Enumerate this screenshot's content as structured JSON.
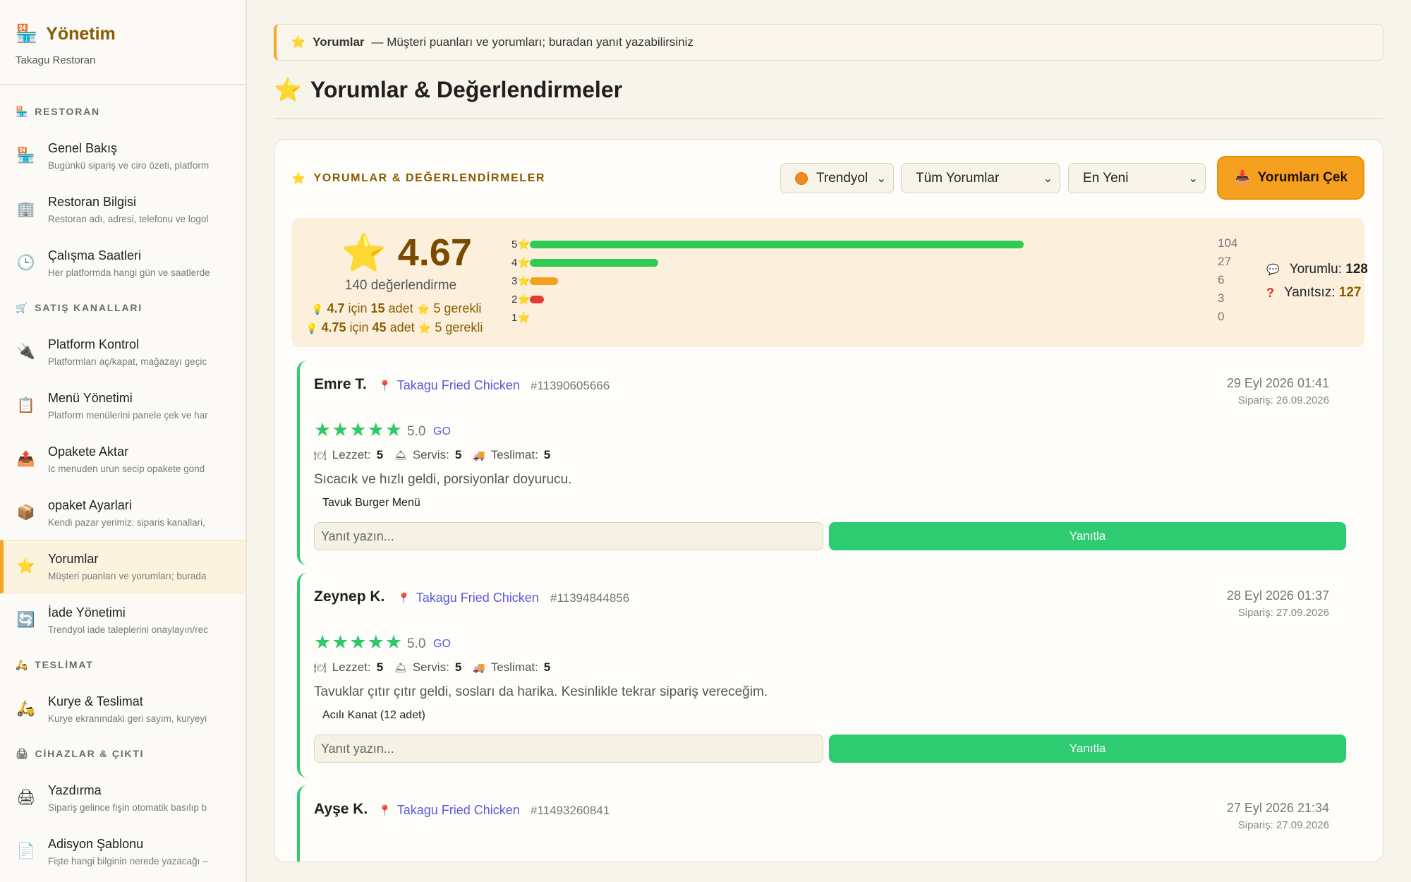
{
  "sidebar": {
    "brand_title": "Yönetim",
    "brand_subtitle": "Takagu Restoran",
    "sections": {
      "restoran": "RESTORAN",
      "satis": "SATIŞ KANALLARI",
      "teslimat": "TESLİMAT",
      "cihazlar": "CİHAZLAR & ÇIKTI"
    },
    "items": [
      {
        "title": "Genel Bakış",
        "desc": "Bugünkü sipariş ve ciro özeti, platform",
        "icon": "🏪"
      },
      {
        "title": "Restoran Bilgisi",
        "desc": "Restoran adı, adresi, telefonu ve logol",
        "icon": "🏢"
      },
      {
        "title": "Çalışma Saatleri",
        "desc": "Her platformda hangi gün ve saatlerde",
        "icon": "🕒"
      },
      {
        "title": "Platform Kontrol",
        "desc": "Platformları aç/kapat, mağazayı geçic",
        "icon": "🔌"
      },
      {
        "title": "Menü Yönetimi",
        "desc": "Platform menülerini panele çek ve har",
        "icon": "📋"
      },
      {
        "title": "Opakete Aktar",
        "desc": "Ic menuden urun secip opakete gond",
        "icon": "📤"
      },
      {
        "title": "opaket Ayarlari",
        "desc": "Kendi pazar yerimiz: siparis kanallari,",
        "icon": "📦"
      },
      {
        "title": "Yorumlar",
        "desc": "Müşteri puanları ve yorumları; burada",
        "icon": "⭐"
      },
      {
        "title": "İade Yönetimi",
        "desc": "Trendyol iade taleplerini onaylayın/rec",
        "icon": "🔄"
      },
      {
        "title": "Kurye & Teslimat",
        "desc": "Kurye ekranındaki geri sayım, kuryeyi",
        "icon": "🛵"
      },
      {
        "title": "Yazdırma",
        "desc": "Sipariş gelince fişin otomatik basılıp b",
        "icon": "🖨"
      },
      {
        "title": "Adisyon Şablonu",
        "desc": "Fişte hangi bilginin nerede yazacağı –",
        "icon": "📄"
      }
    ]
  },
  "banner": {
    "bold": "Yorumlar",
    "text": "— Müşteri puanları ve yorumları; buradan yanıt yazabilirsiniz"
  },
  "page_title": "Yorumlar & Değerlendirmeler",
  "card": {
    "heading": "YORUMLAR & DEĞERLENDİRMELER",
    "platform_select": "Trendyol",
    "filter_select": "Tüm Yorumlar",
    "sort_select": "En Yeni",
    "fetch_button": "Yorumları Çek"
  },
  "summary": {
    "average": "4.67",
    "count_text": "140 değerlendirme",
    "need1": {
      "target": "4.7",
      "mid": "için",
      "count": "15",
      "unit": "adet",
      "stars": "5 gerekli"
    },
    "need2": {
      "target": "4.75",
      "mid": "için",
      "count": "45",
      "unit": "adet",
      "stars": "5 gerekli"
    },
    "distribution": [
      {
        "star": "5",
        "count": 104
      },
      {
        "star": "4",
        "count": 27
      },
      {
        "star": "3",
        "count": 6
      },
      {
        "star": "2",
        "count": 3
      },
      {
        "star": "1",
        "count": 0
      }
    ],
    "with_comment_label": "Yorumlu:",
    "with_comment": "128",
    "unanswered_label": "Yanıtsız:",
    "unanswered": "127"
  },
  "reviews": [
    {
      "name": "Emre T.",
      "branch": "Takagu Fried Chicken",
      "order_no": "#11390605666",
      "date": "29 Eyl 2026 01:41",
      "order_date": "Sipariş: 26.09.2026",
      "stars": "★★★★★",
      "score": "5.0",
      "platform": "GO",
      "taste_label": "Lezzet:",
      "taste": "5",
      "service_label": "Servis:",
      "service": "5",
      "delivery_label": "Teslimat:",
      "delivery": "5",
      "text": "Sıcacık ve hızlı geldi, porsiyonlar doyurucu.",
      "item": "Tavuk Burger Menü",
      "placeholder": "Yanıt yazın...",
      "reply": "Yanıtla"
    },
    {
      "name": "Zeynep K.",
      "branch": "Takagu Fried Chicken",
      "order_no": "#11394844856",
      "date": "28 Eyl 2026 01:37",
      "order_date": "Sipariş: 27.09.2026",
      "stars": "★★★★★",
      "score": "5.0",
      "platform": "GO",
      "taste_label": "Lezzet:",
      "taste": "5",
      "service_label": "Servis:",
      "service": "5",
      "delivery_label": "Teslimat:",
      "delivery": "5",
      "text": "Tavuklar çıtır çıtır geldi, sosları da harika. Kesinlikle tekrar sipariş vereceğim.",
      "item": "Acılı Kanat (12 adet)",
      "placeholder": "Yanıt yazın...",
      "reply": "Yanıtla"
    },
    {
      "name": "Ayşe K.",
      "branch": "Takagu Fried Chicken",
      "order_no": "#11493260841",
      "date": "27 Eyl 2026 21:34",
      "order_date": "Sipariş: 27.09.2026"
    }
  ],
  "colors": {
    "accent": "#f5a623",
    "success": "#2ecc71",
    "brand": "#8a5a00",
    "link": "#5b5bd6"
  }
}
